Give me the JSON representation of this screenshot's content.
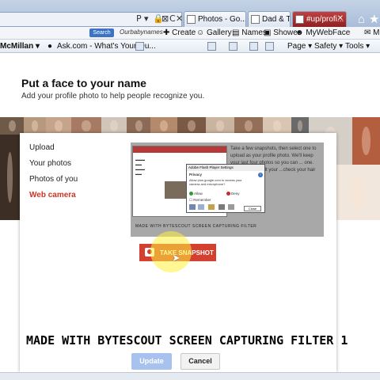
{
  "browser": {
    "address_tail": [
      "P",
      "▾",
      "🔒",
      "⊠",
      "C",
      "✕"
    ],
    "tabs": [
      {
        "label": "Photos - Go..."
      },
      {
        "label": "Dad & Tere..."
      },
      {
        "label": "#up/profi..."
      }
    ],
    "favorites": {
      "search_label": "Search",
      "logo_text": "Ourbabynames",
      "items": [
        "Create",
        "Gallery",
        "Names",
        "Shower",
        "MyWebFace",
        "M"
      ]
    },
    "command_bar": {
      "left": "McMillan ▾",
      "site": "Ask.com - What's Your Qu...",
      "page": "Page ▾",
      "safety": "Safety ▾",
      "tools": "Tools ▾"
    }
  },
  "page": {
    "title": "Put a face to your name",
    "subtitle": "Add your profile photo to help people recognize you."
  },
  "dialog": {
    "nav": [
      "Upload",
      "Your photos",
      "Photos of you",
      "Web camera"
    ],
    "active_nav": "Web camera",
    "preview": {
      "right_text": "Take a few snapshots, then select one to upload as your profile photo. We'll keep your last four photos so you can ... one. ...shot. Slightly tilt your ...check your hair and put",
      "caption": "MADE WITH BYTESCOUT SCREEN CAPTURING FILTER",
      "flash": {
        "title": "Adobe Flash Player Settings",
        "privacy": "Privacy",
        "text": "Allow plus.google.com to access your camera and microphone?",
        "allow": "Allow",
        "deny": "Deny",
        "remember": "Remember",
        "close": "Close"
      }
    },
    "snapshot_label": "TAKE SNAPSHOT",
    "update_label": "Update",
    "cancel_label": "Cancel"
  },
  "watermark": "MADE WITH BYTESCOUT SCREEN CAPTURING FILTER 1",
  "colors": {
    "accent_red": "#d3402f",
    "update_blue": "#a7c2ef",
    "highlight_yellow": "#fff03c"
  }
}
